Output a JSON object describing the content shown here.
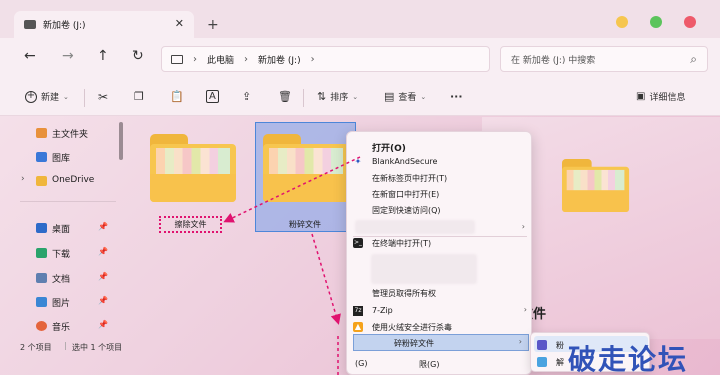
{
  "window": {
    "tab_title": "新加卷 (J:)",
    "tab_close": "✕",
    "tab_add": "+",
    "traffic_colors": {
      "minimize": "#f6c64f",
      "maximize": "#5cc45c",
      "close": "#ee5a6a"
    }
  },
  "nav": {
    "back": "←",
    "forward": "→",
    "up": "↑",
    "refresh": "↻",
    "breadcrumb": [
      "此电脑",
      "新加卷 (J:)"
    ],
    "search_placeholder": "在 新加卷 (J:) 中搜索",
    "search_icon": "⌕"
  },
  "toolbar": {
    "new_label": "新建",
    "sort_label": "排序",
    "view_label": "查看",
    "more_label": "···",
    "details_label": "详细信息"
  },
  "sidebar": {
    "items": [
      {
        "label": "主文件夹",
        "icon": "home-icon",
        "color": "#e8913b"
      },
      {
        "label": "图库",
        "icon": "gallery-icon",
        "color": "#3a78d8"
      },
      {
        "label": "OneDrive",
        "icon": "folder-icon",
        "color": "#f0b63c"
      },
      {
        "label": "桌面",
        "icon": "desktop-icon",
        "color": "#2e6bc9"
      },
      {
        "label": "下载",
        "icon": "download-icon",
        "color": "#2aa36b"
      },
      {
        "label": "文档",
        "icon": "document-icon",
        "color": "#5f7fb0"
      },
      {
        "label": "图片",
        "icon": "pictures-icon",
        "color": "#3a86d4"
      },
      {
        "label": "音乐",
        "icon": "music-icon",
        "color": "#e4643c"
      }
    ],
    "pin_glyph": "📌"
  },
  "files": [
    {
      "name": "擦除文件"
    },
    {
      "name": "粉碎文件"
    }
  ],
  "context_menu": {
    "items": [
      {
        "label": "打开(O)",
        "bold": true
      },
      {
        "label": "BlankAndSecure"
      },
      {
        "label": "在新标签页中打开(T)"
      },
      {
        "label": "在新窗口中打开(E)"
      },
      {
        "label": "固定到快速访问(Q)"
      },
      {
        "label": "在终端中打开(T)"
      },
      {
        "label": "管理员取得所有权"
      },
      {
        "label": "7-Zip"
      },
      {
        "label": "使用火绒安全进行杀毒"
      },
      {
        "label": "碎粉碎文件"
      },
      {
        "label": "(G)"
      },
      {
        "label": "限(G)"
      }
    ],
    "submenu": [
      "粉",
      "解"
    ]
  },
  "preview": {
    "text": "文件"
  },
  "status": {
    "count": "2 个项目",
    "selected": "选中 1 个项目"
  },
  "watermark": "破走论坛"
}
